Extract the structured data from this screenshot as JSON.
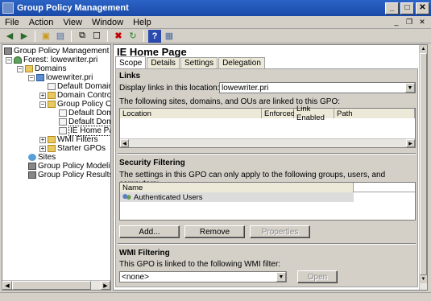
{
  "window": {
    "title": "Group Policy Management",
    "buttons": {
      "minimize": "_",
      "maximize": "□",
      "close": "✕"
    }
  },
  "menu": [
    "File",
    "Action",
    "View",
    "Window",
    "Help"
  ],
  "toolbar": [
    "back-icon",
    "forward-icon",
    "up-folder-icon",
    "show-tree-icon",
    "copy-icon",
    "properties-icon",
    "delete-icon",
    "refresh-icon",
    "help-icon",
    "console-icon"
  ],
  "tree": {
    "root": "Group Policy Management",
    "forest": "Forest: lowewriter.pri",
    "domains": "Domains",
    "domain": "lowewriter.pri",
    "default_domain_policy": "Default Domain Po",
    "domain_controllers": "Domain Controller",
    "gpo_objects": "Group Policy Obje",
    "gpo_child_1": "Default Doma",
    "gpo_child_2": "Default Doma",
    "gpo_selected": "IE Home Page",
    "wmi_filters": "WMI Filters",
    "starter_gpos": "Starter GPOs",
    "sites": "Sites",
    "modeling": "Group Policy Modeling",
    "results": "Group Policy Results"
  },
  "details": {
    "title": "IE Home Page",
    "tabs": [
      "Scope",
      "Details",
      "Settings",
      "Delegation"
    ],
    "links": {
      "heading": "Links",
      "display_label": "Display links in this location:",
      "location_value": "lowewriter.pri",
      "linked_text": "The following sites, domains, and OUs are linked to this GPO:",
      "columns": [
        "Location",
        "Enforced",
        "Link Enabled",
        "Path"
      ]
    },
    "security": {
      "heading": "Security Filtering",
      "text": "The settings in this GPO can only apply to the following groups, users, and computers:",
      "column": "Name",
      "rows": [
        "Authenticated Users"
      ],
      "buttons": {
        "add": "Add...",
        "remove": "Remove",
        "properties": "Properties"
      }
    },
    "wmi": {
      "heading": "WMI Filtering",
      "text": "This GPO is linked to the following WMI filter:",
      "filter_value": "<none>",
      "open_button": "Open"
    }
  },
  "colors": {
    "titlebar": "#1a4aa8",
    "face": "#d4d0c8"
  }
}
